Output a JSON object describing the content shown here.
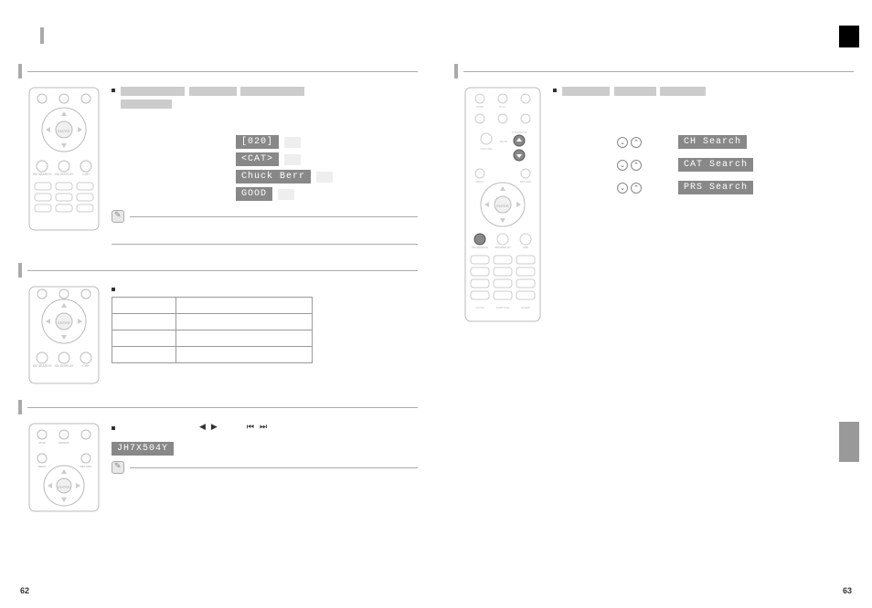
{
  "page_left_num": "62",
  "page_right_num": "63",
  "displays": {
    "d1": "[020]",
    "d2": "<CAT>",
    "d3": "Chuck Berr",
    "d4": "GOOD"
  },
  "id_code": "JH7X504Y",
  "search_modes": {
    "s1": "CH  Search",
    "s2": "CAT Search",
    "s3": "PRS Search"
  },
  "controls": {
    "left": "◀",
    "right": "▶",
    "prev": "⏮",
    "next": "⏭"
  },
  "arrow_down": "⌄",
  "arrow_up": "⌃"
}
